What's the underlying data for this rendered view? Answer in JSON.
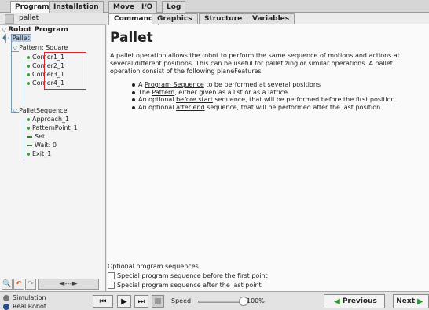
{
  "top_tabs": [
    "Program",
    "Installation",
    "Move",
    "I/O",
    "Log"
  ],
  "program": {
    "name": "pallet"
  },
  "tree": {
    "root": "Robot Program",
    "pallet": "Pallet",
    "pattern": "Pattern: Square",
    "corners": [
      "Corner1_1",
      "Corner2_1",
      "Corner3_1",
      "Corner4_1"
    ],
    "sequence": "PalletSequence",
    "seq_items": [
      "Approach_1",
      "PatternPoint_1",
      "Set",
      "Wait: 0",
      "Exit_1"
    ]
  },
  "left_bottom": {
    "arrows": "◄---►"
  },
  "sub_tabs": [
    "Command",
    "Graphics",
    "Structure",
    "Variables"
  ],
  "content": {
    "title": "Pallet",
    "paragraph": "A pallet operation allows the robot to perform the same sequence of motions and actions at several different positions. This can be useful for palletizing or similar operations. A pallet operation consist of the following planeFeatures",
    "bullets": [
      {
        "pre": "A ",
        "link": "Program Sequence",
        "post": " to be performed at several positions"
      },
      {
        "pre": "The ",
        "link": "Pattern",
        "post": ", either given as a list or as a lattice."
      },
      {
        "pre": "An optional ",
        "link": "before start",
        "post": " sequence, that will be performed before the first position."
      },
      {
        "pre": "An optional ",
        "link": "after end",
        "post": " sequence, that will be performed after the last position."
      }
    ],
    "optional_label": "Optional program sequences",
    "opt_before": "Special program sequence before the first point",
    "opt_after": "Special program sequence after the last point"
  },
  "bottom": {
    "mode1": "Simulation",
    "mode2": "Real Robot",
    "speed_label": "Speed",
    "speed_value": "100%",
    "speed_fraction": 1.0,
    "previous": "Previous",
    "next": "Next"
  }
}
